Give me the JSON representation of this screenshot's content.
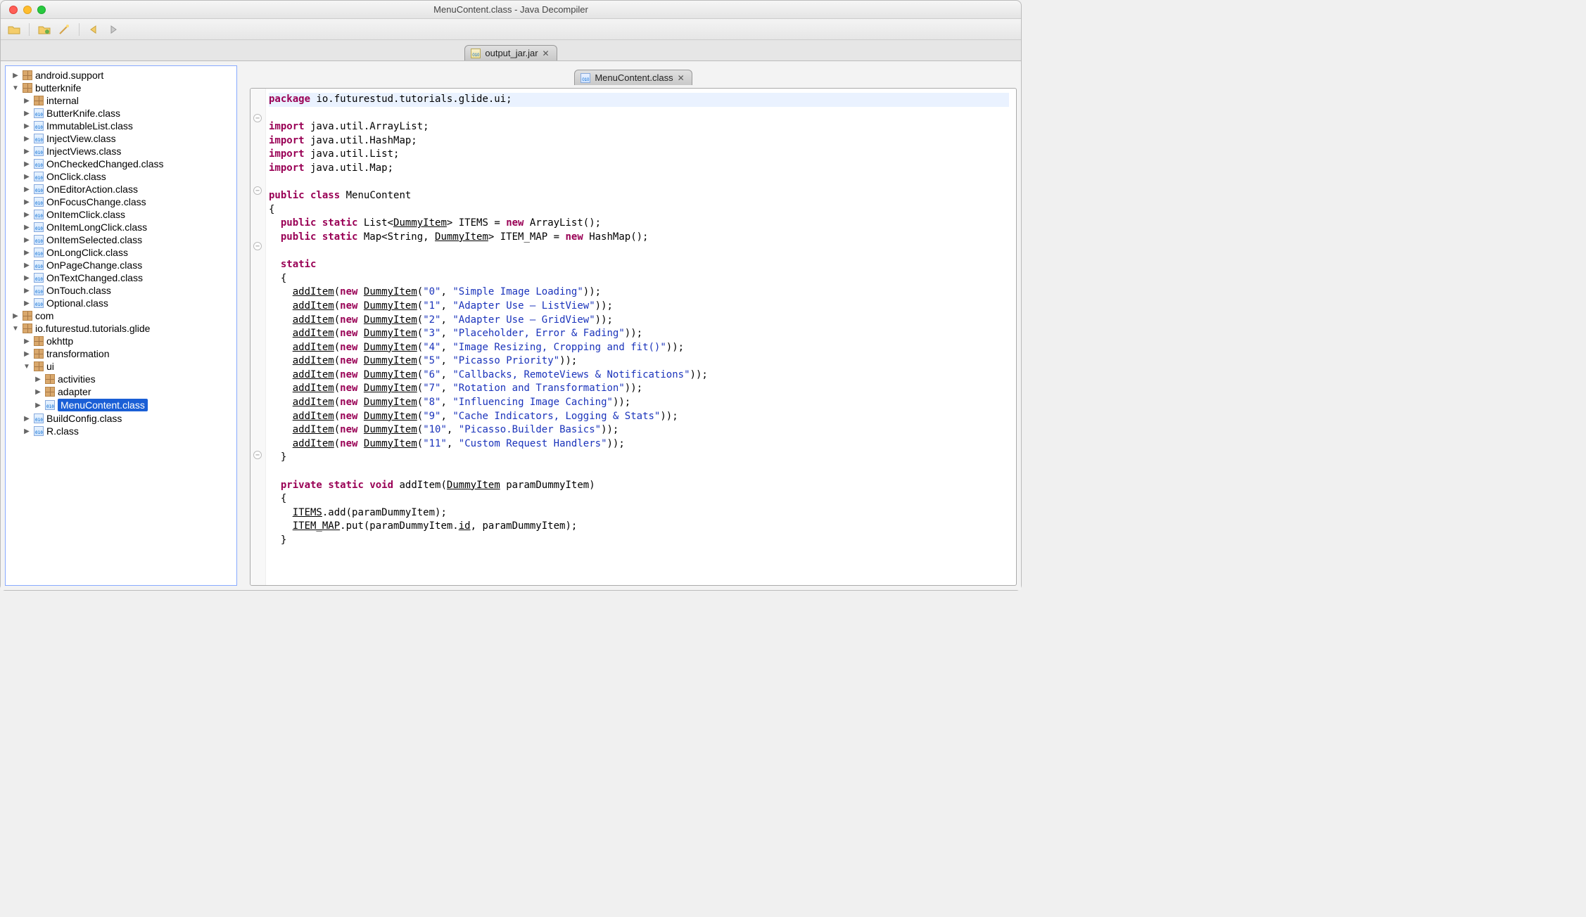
{
  "window": {
    "title": "MenuContent.class - Java Decompiler"
  },
  "toolbar": {
    "open_icon": "open-icon",
    "folder_icon": "open-type-icon",
    "wand_icon": "search-icon",
    "back_icon": "back-icon",
    "fwd_icon": "forward-icon"
  },
  "main_tab": {
    "label": "output_jar.jar"
  },
  "editor_tab": {
    "label": "MenuContent.class"
  },
  "tree": [
    {
      "ind": 0,
      "arrow": "▶",
      "icon": "pkg",
      "label": "android.support"
    },
    {
      "ind": 0,
      "arrow": "▼",
      "icon": "pkg",
      "label": "butterknife"
    },
    {
      "ind": 1,
      "arrow": "▶",
      "icon": "pkg",
      "label": "internal"
    },
    {
      "ind": 1,
      "arrow": "▶",
      "icon": "cls",
      "label": "ButterKnife.class"
    },
    {
      "ind": 1,
      "arrow": "▶",
      "icon": "cls",
      "label": "ImmutableList.class"
    },
    {
      "ind": 1,
      "arrow": "▶",
      "icon": "cls",
      "label": "InjectView.class"
    },
    {
      "ind": 1,
      "arrow": "▶",
      "icon": "cls",
      "label": "InjectViews.class"
    },
    {
      "ind": 1,
      "arrow": "▶",
      "icon": "cls",
      "label": "OnCheckedChanged.class"
    },
    {
      "ind": 1,
      "arrow": "▶",
      "icon": "cls",
      "label": "OnClick.class"
    },
    {
      "ind": 1,
      "arrow": "▶",
      "icon": "cls",
      "label": "OnEditorAction.class"
    },
    {
      "ind": 1,
      "arrow": "▶",
      "icon": "cls",
      "label": "OnFocusChange.class"
    },
    {
      "ind": 1,
      "arrow": "▶",
      "icon": "cls",
      "label": "OnItemClick.class"
    },
    {
      "ind": 1,
      "arrow": "▶",
      "icon": "cls",
      "label": "OnItemLongClick.class"
    },
    {
      "ind": 1,
      "arrow": "▶",
      "icon": "cls",
      "label": "OnItemSelected.class"
    },
    {
      "ind": 1,
      "arrow": "▶",
      "icon": "cls",
      "label": "OnLongClick.class"
    },
    {
      "ind": 1,
      "arrow": "▶",
      "icon": "cls",
      "label": "OnPageChange.class"
    },
    {
      "ind": 1,
      "arrow": "▶",
      "icon": "cls",
      "label": "OnTextChanged.class"
    },
    {
      "ind": 1,
      "arrow": "▶",
      "icon": "cls",
      "label": "OnTouch.class"
    },
    {
      "ind": 1,
      "arrow": "▶",
      "icon": "cls",
      "label": "Optional.class"
    },
    {
      "ind": 0,
      "arrow": "▶",
      "icon": "pkg",
      "label": "com"
    },
    {
      "ind": 0,
      "arrow": "▼",
      "icon": "pkg",
      "label": "io.futurestud.tutorials.glide"
    },
    {
      "ind": 1,
      "arrow": "▶",
      "icon": "pkg",
      "label": "okhttp"
    },
    {
      "ind": 1,
      "arrow": "▶",
      "icon": "pkg",
      "label": "transformation"
    },
    {
      "ind": 1,
      "arrow": "▼",
      "icon": "pkg",
      "label": "ui"
    },
    {
      "ind": 2,
      "arrow": "▶",
      "icon": "pkg",
      "label": "activities"
    },
    {
      "ind": 2,
      "arrow": "▶",
      "icon": "pkg",
      "label": "adapter"
    },
    {
      "ind": 2,
      "arrow": "▶",
      "icon": "cls",
      "label": "MenuContent.class",
      "selected": true
    },
    {
      "ind": 1,
      "arrow": "▶",
      "icon": "cls",
      "label": "BuildConfig.class"
    },
    {
      "ind": 1,
      "arrow": "▶",
      "icon": "cls",
      "label": "R.class"
    }
  ],
  "code": {
    "package_kw": "package",
    "package_name": " io.futurestud.tutorials.glide.ui;",
    "import_kw": "import",
    "imports": [
      " java.util.ArrayList;",
      " java.util.HashMap;",
      " java.util.List;",
      " java.util.Map;"
    ],
    "public_kw": "public",
    "class_kw": "class",
    "classname": " MenuContent",
    "static_kw": "static",
    "new_kw": "new",
    "void_kw": "void",
    "private_kw": "private",
    "items_decl_pre": " List<",
    "dummy": "DummyItem",
    "items_decl_post": "> ITEMS = ",
    "arraylist": " ArrayList();",
    "map_decl_pre": " Map<String, ",
    "map_decl_post": "> ITEM_MAP = ",
    "hashmap": " HashMap();",
    "addItem": "addItem",
    "entries": [
      {
        "id": "\"0\"",
        "title": "\"Simple Image Loading\""
      },
      {
        "id": "\"1\"",
        "title": "\"Adapter Use — ListView\""
      },
      {
        "id": "\"2\"",
        "title": "\"Adapter Use — GridView\""
      },
      {
        "id": "\"3\"",
        "title": "\"Placeholder, Error & Fading\""
      },
      {
        "id": "\"4\"",
        "title": "\"Image Resizing, Cropping and fit()\""
      },
      {
        "id": "\"5\"",
        "title": "\"Picasso Priority\""
      },
      {
        "id": "\"6\"",
        "title": "\"Callbacks, RemoteViews & Notifications\""
      },
      {
        "id": "\"7\"",
        "title": "\"Rotation and Transformation\""
      },
      {
        "id": "\"8\"",
        "title": "\"Influencing Image Caching\""
      },
      {
        "id": "\"9\"",
        "title": "\"Cache Indicators, Logging & Stats\""
      },
      {
        "id": "\"10\"",
        "title": "\"Picasso.Builder Basics\""
      },
      {
        "id": "\"11\"",
        "title": "\"Custom Request Handlers\""
      }
    ],
    "addmethod_sig": " addItem(",
    "addmethod_param": " paramDummyItem)",
    "body1": ".add(paramDummyItem);",
    "body2_a": ".put(paramDummyItem.",
    "body2_b": ", paramDummyItem);",
    "ITEMS": "ITEMS",
    "ITEM_MAP": "ITEM_MAP",
    "id_field": "id"
  }
}
